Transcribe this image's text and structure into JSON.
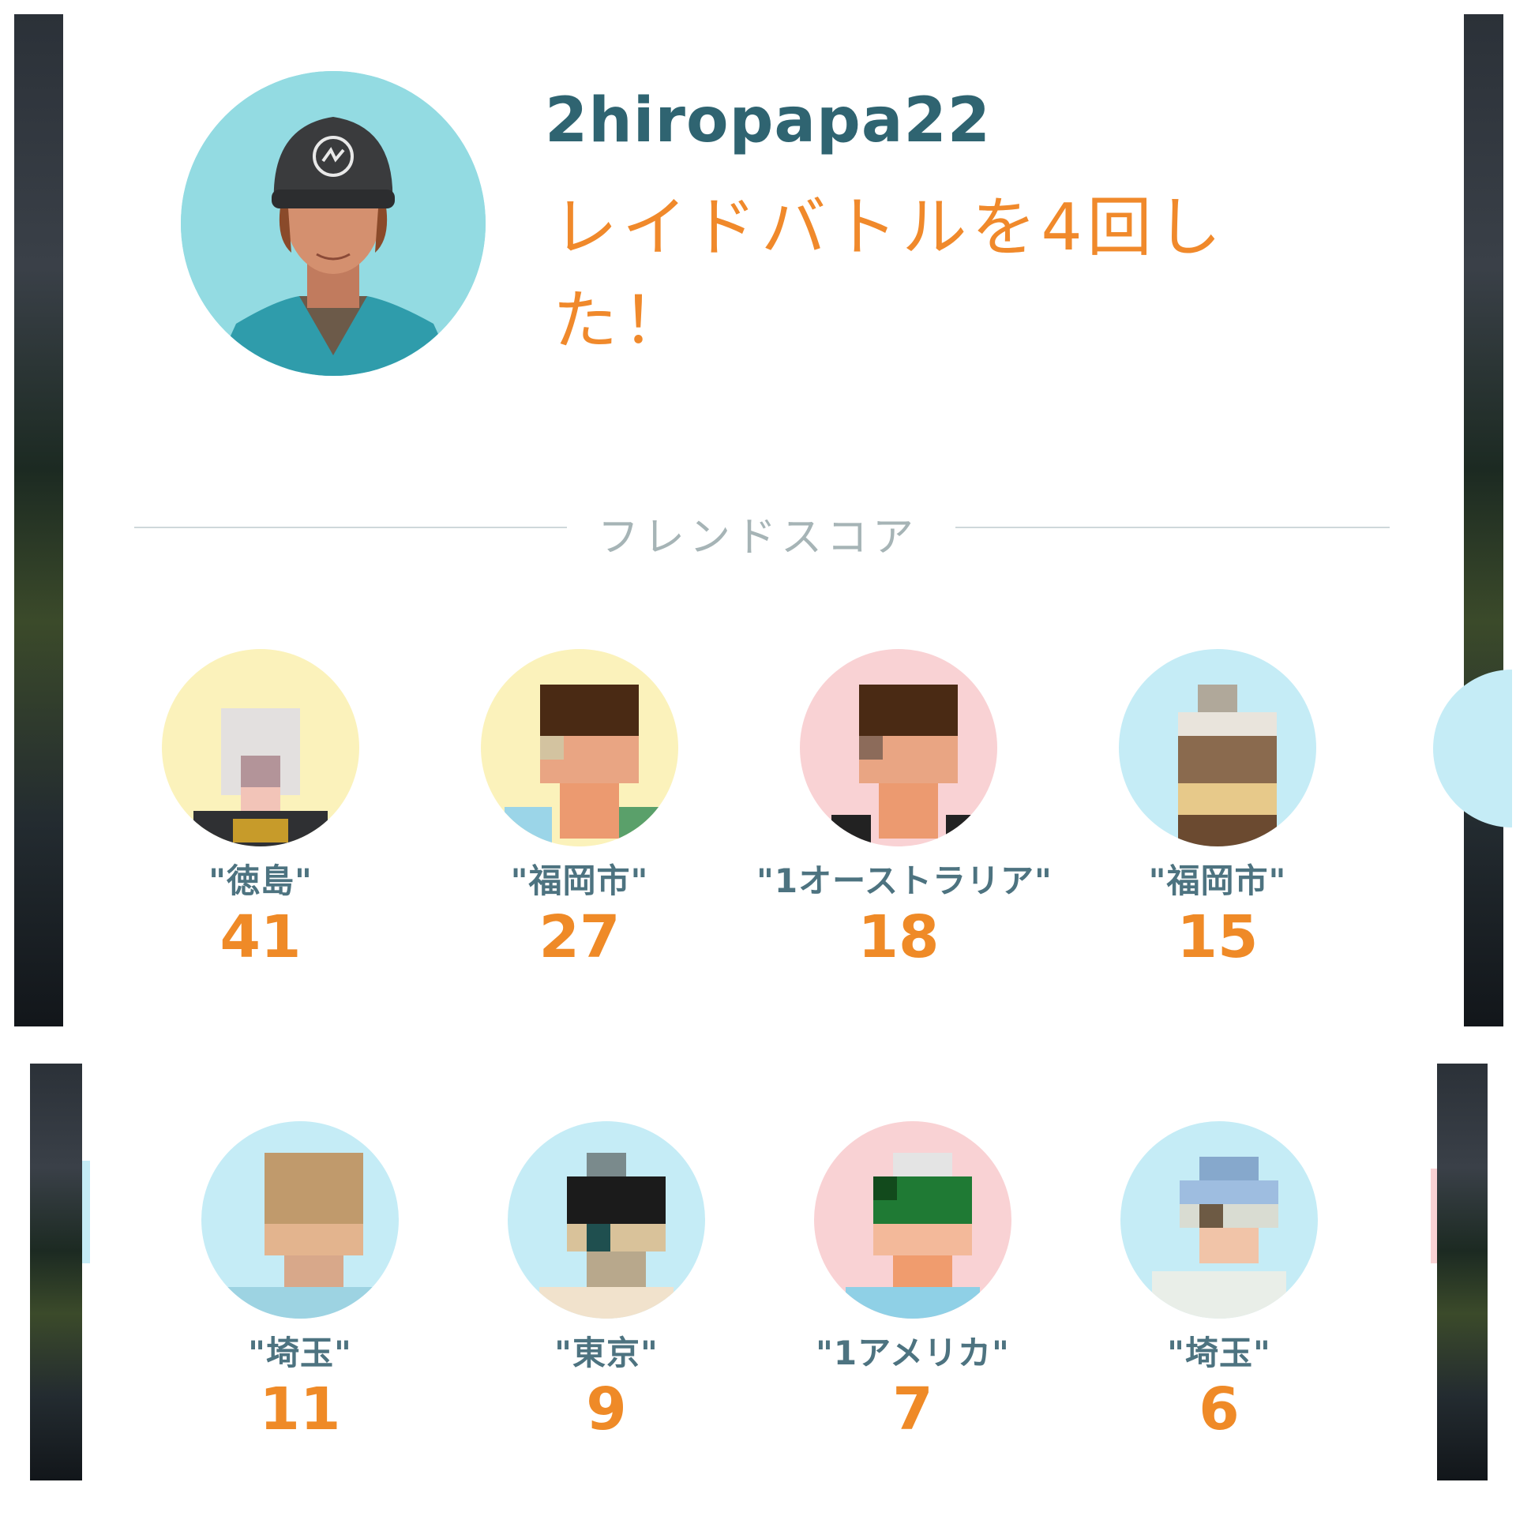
{
  "profile": {
    "username": "2hiropapa22",
    "activity": "レイドバトルを4回した！"
  },
  "section": {
    "title": "フレンドスコア"
  },
  "colors": {
    "accent_orange": "#ef8a27",
    "name_teal": "#2f6471",
    "divider": "#cfd8da"
  },
  "friends_top": [
    {
      "name": "\"徳島\"",
      "score": "41"
    },
    {
      "name": "\"福岡市\"",
      "score": "27"
    },
    {
      "name": "\"1オーストラリア\"",
      "score": "18"
    },
    {
      "name": "\"福岡市\"",
      "score": "15"
    }
  ],
  "friends_bottom": [
    {
      "name": "\"埼玉\"",
      "score": "11"
    },
    {
      "name": "\"東京\"",
      "score": "9"
    },
    {
      "name": "\"1アメリカ\"",
      "score": "7"
    },
    {
      "name": "\"埼玉\"",
      "score": "6"
    }
  ]
}
